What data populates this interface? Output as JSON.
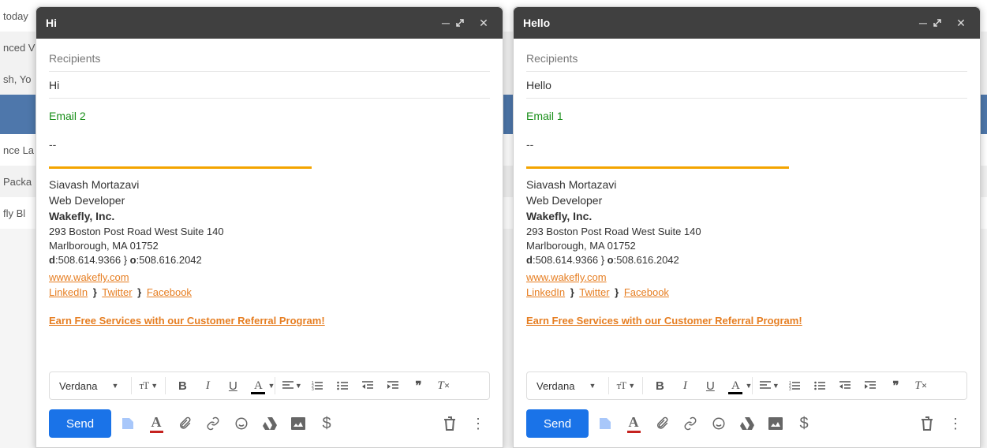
{
  "background": {
    "row1": "today",
    "row2": "nced V",
    "row3": "sh, Yo",
    "row5": "nce La",
    "row6": "Packa",
    "row7": "fly Bl"
  },
  "windows": [
    {
      "title": "Hi",
      "recipients_placeholder": "Recipients",
      "subject": "Hi",
      "body_greeting": "Email 2",
      "separator": "--"
    },
    {
      "title": "Hello",
      "recipients_placeholder": "Recipients",
      "subject": "Hello",
      "body_greeting": "Email 1",
      "separator": "--"
    }
  ],
  "signature": {
    "name": "Siavash Mortazavi",
    "role": "Web Developer",
    "company": "Wakefly, Inc.",
    "addr1": "293 Boston Post Road West Suite 140",
    "addr2": "Marlborough, MA 01752",
    "phone_d_label": "d",
    "phone_d": ":508.614.9366",
    "phone_sep": " } ",
    "phone_o_label": "o",
    "phone_o": ":508.616.2042",
    "website": "www.wakefly.com",
    "social_linkedin": "LinkedIn",
    "social_twitter": "Twitter",
    "social_facebook": "Facebook",
    "social_sep": "}",
    "referral": "Earn Free Services with our Customer Referral Program!"
  },
  "format": {
    "font": "Verdana"
  },
  "actions": {
    "send": "Send"
  }
}
